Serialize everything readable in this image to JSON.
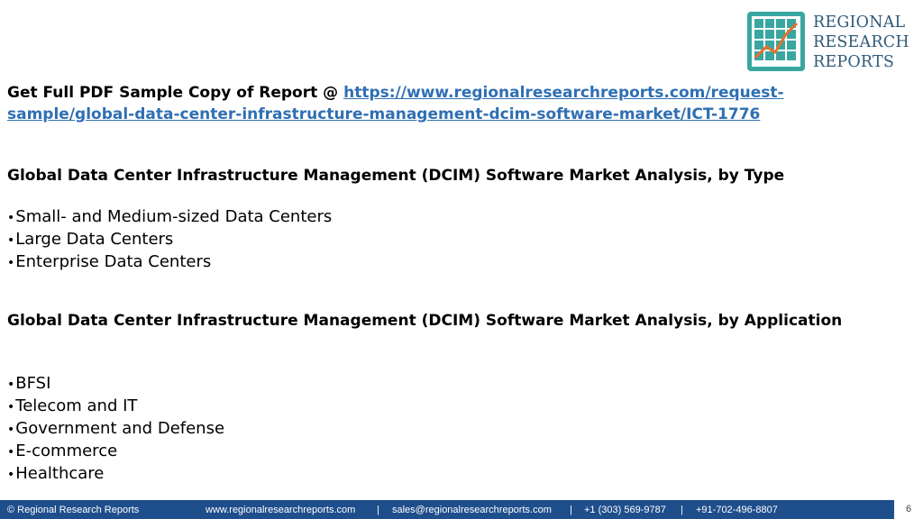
{
  "brand": {
    "line1": "REGIONAL",
    "line2": "RESEARCH",
    "line3": "REPORTS"
  },
  "cta": {
    "prefix": "Get Full PDF Sample Copy of Report @ ",
    "link_text": "https://www.regionalresearchreports.com/request-sample/global-data-center-infrastructure-management-dcim-software-market/ICT-1776",
    "href": "https://www.regionalresearchreports.com/request-sample/global-data-center-infrastructure-management-dcim-software-market/ICT-1776"
  },
  "sections": {
    "type": {
      "heading": "Global Data Center Infrastructure Management (DCIM) Software Market Analysis, by Type",
      "items": [
        "Small- and Medium-sized Data Centers",
        "Large Data Centers",
        "Enterprise Data Centers"
      ]
    },
    "application": {
      "heading": "Global Data Center Infrastructure Management (DCIM) Software Market Analysis, by Application",
      "items": [
        "BFSI",
        "Telecom and IT",
        "Government and Defense",
        "E-commerce",
        "Healthcare"
      ]
    }
  },
  "footer": {
    "copyright": "© Regional Research Reports",
    "website": "www.regionalresearchreports.com",
    "sep": "|",
    "email": "sales@regionalresearchreports.com",
    "phone1": "+1 (303) 569-9787",
    "phone2": "+91-702-496-8807",
    "page": "6"
  },
  "colors": {
    "link": "#2f6fb3",
    "footer_bg": "#1f4e8c",
    "brand_text": "#2f5a7a",
    "brand_teal": "#3aa6a0"
  }
}
